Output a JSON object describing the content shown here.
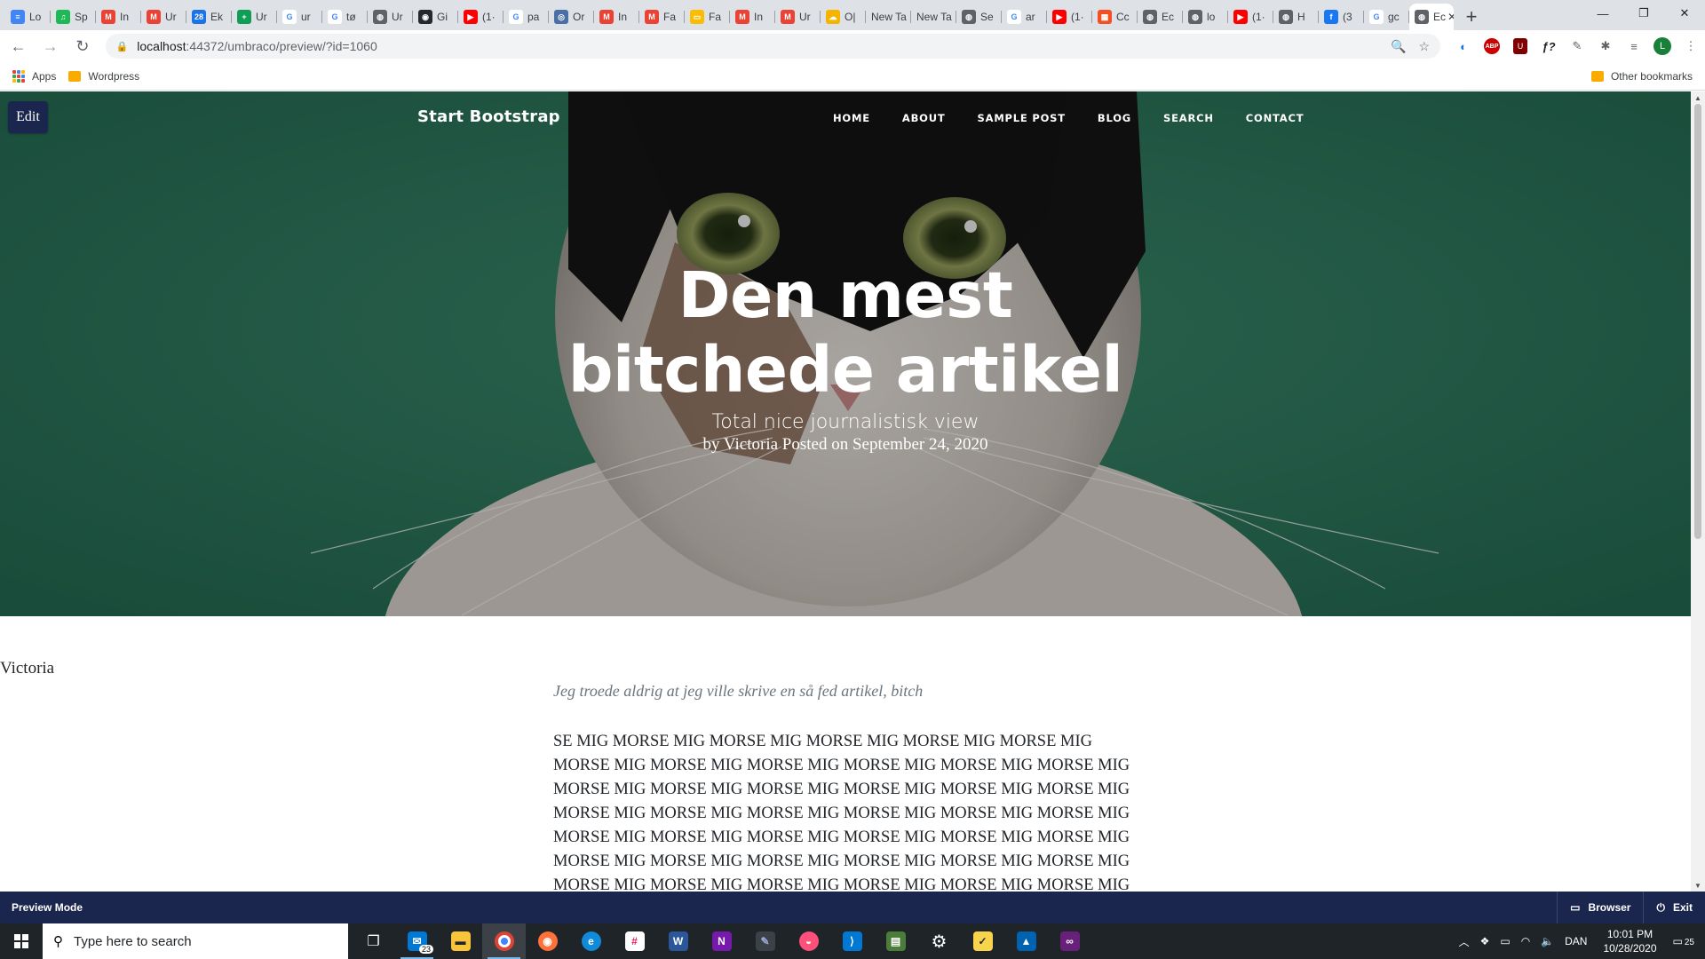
{
  "browser": {
    "tabs": [
      {
        "label": "Lo",
        "fav_color": "#4285f4",
        "fav_text": "≡"
      },
      {
        "label": "Sp",
        "fav_color": "#1db954",
        "fav_text": "♫"
      },
      {
        "label": "In",
        "fav_color": "#ea4335",
        "fav_text": "M"
      },
      {
        "label": "Ur",
        "fav_color": "#ea4335",
        "fav_text": "M"
      },
      {
        "label": "Ek",
        "fav_color": "#1a73e8",
        "fav_text": "28"
      },
      {
        "label": "Ur",
        "fav_color": "#0f9d58",
        "fav_text": "+"
      },
      {
        "label": "ur",
        "fav_color": "#ffffff",
        "fav_text": "G"
      },
      {
        "label": "tø",
        "fav_color": "#ffffff",
        "fav_text": "G"
      },
      {
        "label": "Ur",
        "fav_color": "#5f6368",
        "fav_text": "◍"
      },
      {
        "label": "Gi",
        "fav_color": "#24292e",
        "fav_text": "◉"
      },
      {
        "label": "(1·",
        "fav_color": "#ff0000",
        "fav_text": "▶"
      },
      {
        "label": "pa",
        "fav_color": "#ffffff",
        "fav_text": "G"
      },
      {
        "label": "Or",
        "fav_color": "#4a6fa5",
        "fav_text": "◎"
      },
      {
        "label": "In",
        "fav_color": "#ea4335",
        "fav_text": "M"
      },
      {
        "label": "Fa",
        "fav_color": "#ea4335",
        "fav_text": "M"
      },
      {
        "label": "Fa",
        "fav_color": "#fbbc04",
        "fav_text": "▭"
      },
      {
        "label": "In",
        "fav_color": "#ea4335",
        "fav_text": "M"
      },
      {
        "label": "Ur",
        "fav_color": "#ea4335",
        "fav_text": "M"
      },
      {
        "label": "O|",
        "fav_color": "#f4b400",
        "fav_text": "☁"
      },
      {
        "label": "New Ta",
        "fav_color": "",
        "fav_text": ""
      },
      {
        "label": "New Ta",
        "fav_color": "",
        "fav_text": ""
      },
      {
        "label": "Se",
        "fav_color": "#5f6368",
        "fav_text": "◍"
      },
      {
        "label": "ar",
        "fav_color": "#ffffff",
        "fav_text": "G"
      },
      {
        "label": "(1·",
        "fav_color": "#ff0000",
        "fav_text": "▶"
      },
      {
        "label": "Cc",
        "fav_color": "#f25022",
        "fav_text": "▦"
      },
      {
        "label": "Ec",
        "fav_color": "#5f6368",
        "fav_text": "◍"
      },
      {
        "label": "lo",
        "fav_color": "#5f6368",
        "fav_text": "◍"
      },
      {
        "label": "(1·",
        "fav_color": "#ff0000",
        "fav_text": "▶"
      },
      {
        "label": "H",
        "fav_color": "#5f6368",
        "fav_text": "◍"
      },
      {
        "label": "(3",
        "fav_color": "#1877f2",
        "fav_text": "f"
      },
      {
        "label": "gc",
        "fav_color": "#ffffff",
        "fav_text": "G"
      },
      {
        "label": "Ec",
        "fav_color": "#5f6368",
        "fav_text": "◍"
      }
    ],
    "active_tab_close": "✕",
    "new_tab": "+",
    "window_controls": {
      "minimize": "—",
      "restore": "❐",
      "close": "✕"
    },
    "nav": {
      "back": "←",
      "forward": "→",
      "reload": "↻"
    },
    "url_host": "localhost",
    "url_path": ":44372/umbraco/preview/?id=1060",
    "omnibox_icons": {
      "zoom": "🔍",
      "star": "☆"
    },
    "extensions": [
      "◐",
      "ABP",
      "U",
      "ƒ?",
      "✎",
      "✱",
      "≡"
    ],
    "profile_initial": "L",
    "menu": "⋮",
    "bookmarks": {
      "apps": "Apps",
      "wordpress": "Wordpress",
      "other": "Other bookmarks"
    }
  },
  "page": {
    "edit_button": "Edit",
    "brand": "Start Bootstrap",
    "nav": [
      "HOME",
      "ABOUT",
      "SAMPLE POST",
      "BLOG",
      "SEARCH",
      "CONTACT"
    ],
    "title_line1": "Den mest",
    "title_line2": "bitchede artikel",
    "subtitle": "Total nice journalistisk view",
    "meta": "by Victoria Posted on September 24, 2020",
    "author": "Victoria",
    "lead": "Jeg troede aldrig at jeg ville skrive en så fed artikel, bitch",
    "body_lines": [
      "SE MIG MORSE MIG MORSE MIG MORSE MIG MORSE MIG MORSE MIG",
      "MORSE MIG MORSE MIG MORSE MIG MORSE MIG MORSE MIG MORSE MIG",
      "MORSE MIG MORSE MIG MORSE MIG MORSE MIG MORSE MIG MORSE MIG",
      "MORSE MIG MORSE MIG MORSE MIG MORSE MIG MORSE MIG MORSE MIG",
      "MORSE MIG MORSE MIG MORSE MIG MORSE MIG MORSE MIG MORSE MIG",
      "MORSE MIG MORSE MIG MORSE MIG MORSE MIG MORSE MIG MORSE MIG",
      "MORSE MIG MORSE MIG MORSE MIG MORSE MIG MORSE MIG MORSE MIG"
    ],
    "hero_bg_color": "#2f7b62"
  },
  "preview_bar": {
    "label": "Preview Mode",
    "browser": "Browser",
    "exit": "Exit",
    "color": "#1b264f"
  },
  "taskbar": {
    "search_placeholder": "Type here to search",
    "mail_badge": "23",
    "tray_language": "DAN",
    "time": "10:01 PM",
    "date": "10/28/2020",
    "notifications": "25"
  }
}
